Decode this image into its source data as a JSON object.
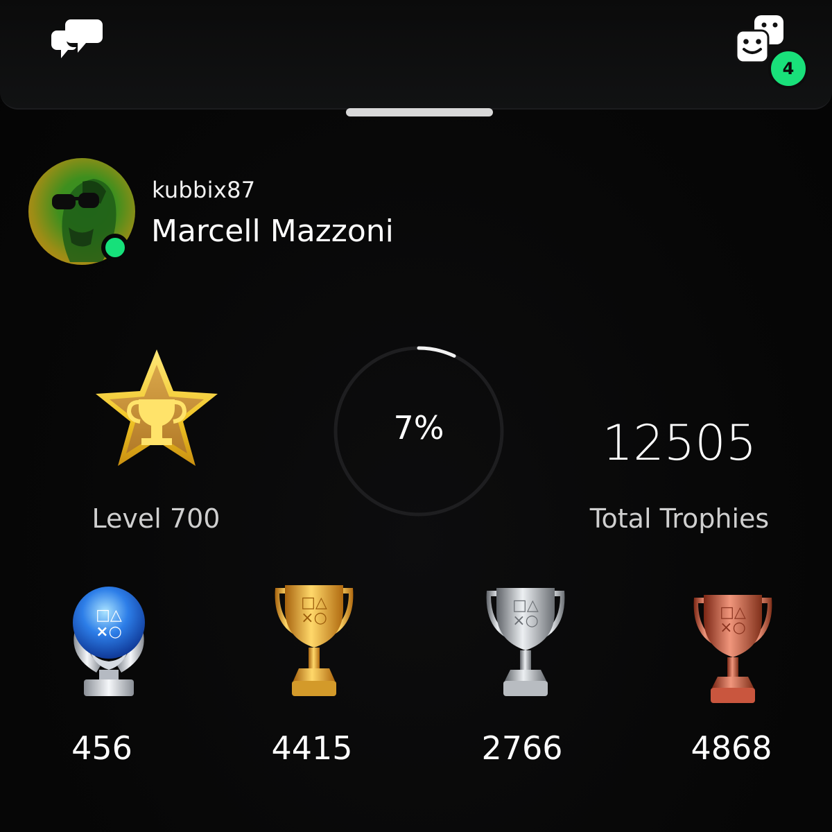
{
  "header": {
    "chat_icon": "chat-bubbles-icon",
    "party_icon": "party-faces-icon",
    "party_count": "4"
  },
  "profile": {
    "username": "kubbix87",
    "real_name": "Marcell Mazzoni",
    "status": "online",
    "status_color": "#16e07a"
  },
  "stats": {
    "level_label": "Level 700",
    "level_progress_label": "7%",
    "level_progress": 0.07,
    "total_trophies": "12505",
    "total_trophies_label": "Total Trophies"
  },
  "trophies": {
    "platinum": {
      "icon": "platinum-trophy-icon",
      "count": "456"
    },
    "gold": {
      "icon": "gold-trophy-icon",
      "count": "4415"
    },
    "silver": {
      "icon": "silver-trophy-icon",
      "count": "2766"
    },
    "bronze": {
      "icon": "bronze-trophy-icon",
      "count": "4868"
    }
  },
  "colors": {
    "accent_green": "#16e07a",
    "background": "#050505",
    "gold": "#e9c23a",
    "silver": "#c9c9c9",
    "bronze": "#c9563e",
    "platinum": "#2d7ee8"
  }
}
